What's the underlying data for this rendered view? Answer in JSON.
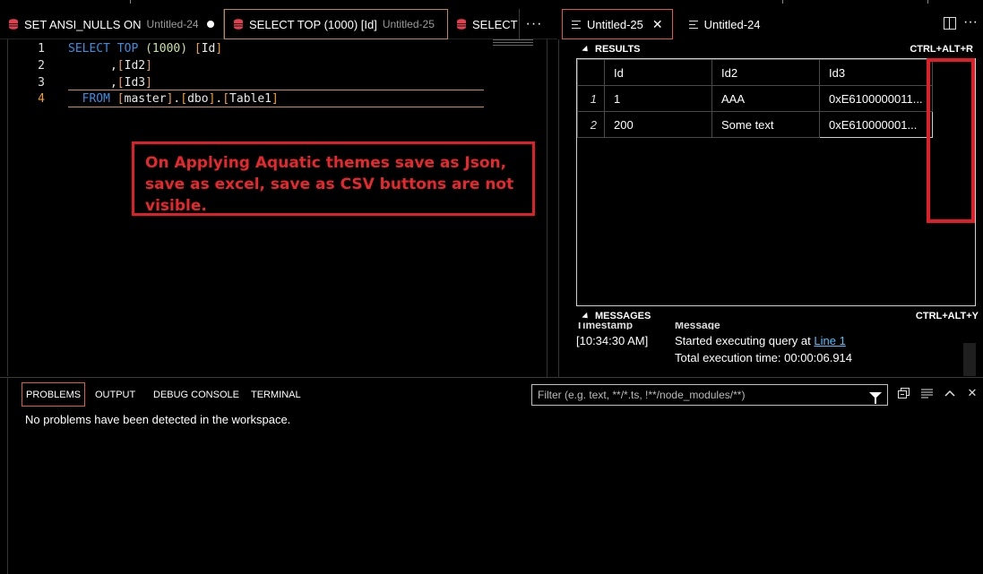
{
  "editor_tabs": [
    {
      "label": "SET ANSI_NULLS ON",
      "sub": "Untitled-24",
      "modified": true
    },
    {
      "label": "SELECT TOP (1000) [Id]",
      "sub": "Untitled-25",
      "modified": true,
      "active": true
    },
    {
      "label": "SELECT",
      "sub": "",
      "modified": false
    }
  ],
  "results_tabs": [
    {
      "label": "Untitled-25",
      "active": true
    },
    {
      "label": "Untitled-24",
      "active": false
    }
  ],
  "code": {
    "lines": [
      {
        "num": "1",
        "text": "SELECT TOP (1000) [Id]"
      },
      {
        "num": "2",
        "text": ",[Id2]"
      },
      {
        "num": "3",
        "text": ",[Id3]"
      },
      {
        "num": "4",
        "text": "FROM [master].[dbo].[Table1]"
      }
    ]
  },
  "annotation": "On Applying Aquatic themes save as Json, save as excel, save as CSV buttons are not visible.",
  "results": {
    "title": "RESULTS",
    "shortcut": "CTRL+ALT+R",
    "columns": [
      "Id",
      "Id2",
      "Id3"
    ],
    "rows": [
      {
        "num": "1",
        "cells": [
          "1",
          "AAA",
          "0xE6100000011..."
        ]
      },
      {
        "num": "2",
        "cells": [
          "200",
          "Some text",
          "0xE610000001..."
        ]
      }
    ]
  },
  "messages": {
    "title": "MESSAGES",
    "shortcut": "CTRL+ALT+Y",
    "col_timestamp": "Timestamp",
    "col_message": "Message",
    "timestamp": "[10:34:30 AM]",
    "line1_prefix": "Started executing query at ",
    "line1_link": "Line 1",
    "line2": "Total execution time: 00:00:06.914"
  },
  "panel": {
    "tabs": [
      "PROBLEMS",
      "OUTPUT",
      "DEBUG CONSOLE",
      "TERMINAL"
    ],
    "active_tab": "PROBLEMS",
    "filter_placeholder": "Filter (e.g. text, **/*.ts, !**/node_modules/**)",
    "status_text": "No problems have been detected in the workspace."
  },
  "colors": {
    "keyword": "#3c8ee0",
    "bracket": "#f0a030",
    "annotation": "#e8272d",
    "link": "#4fc0ff",
    "db_icon": "#e04050"
  }
}
